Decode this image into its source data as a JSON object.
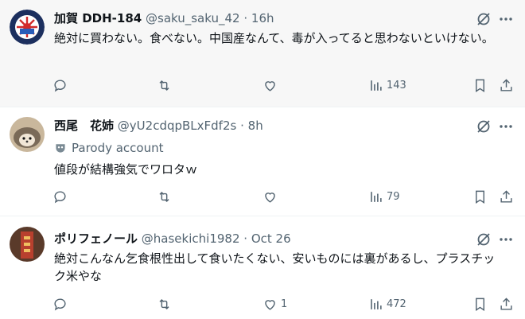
{
  "tweets": [
    {
      "name": "加賀 DDH-184",
      "handle": "@saku_saku_42",
      "sep": "·",
      "time": "16h",
      "text": "絶対に買わない。食べない。中国産なんて、毒が入ってると思わないといけない。",
      "likes": "",
      "views": "143"
    },
    {
      "name": "西尾　花姉",
      "handle": "@yU2cdqpBLxFdf2s",
      "sep": "·",
      "time": "8h",
      "badge": "Parody account",
      "text": "値段が結構強気でワロタｗ",
      "likes": "",
      "views": "79"
    },
    {
      "name": "ポリフェノール",
      "handle": "@hasekichi1982",
      "sep": "·",
      "time": "Oct 26",
      "text": "絶対こんなん乞食根性出して食いたくない、安いものには裏があるし、プラスチック米やな",
      "likes": "1",
      "views": "472"
    }
  ],
  "icons": {
    "reply": "reply-icon",
    "retweet": "retweet-icon",
    "like": "heart-icon",
    "views": "views-icon",
    "bookmark": "bookmark-icon",
    "share": "share-icon",
    "grok": "grok-icon",
    "more": "more-icon"
  },
  "colors": {
    "text": "#0f1419",
    "secondary": "#536471",
    "divider": "#eff3f4"
  }
}
